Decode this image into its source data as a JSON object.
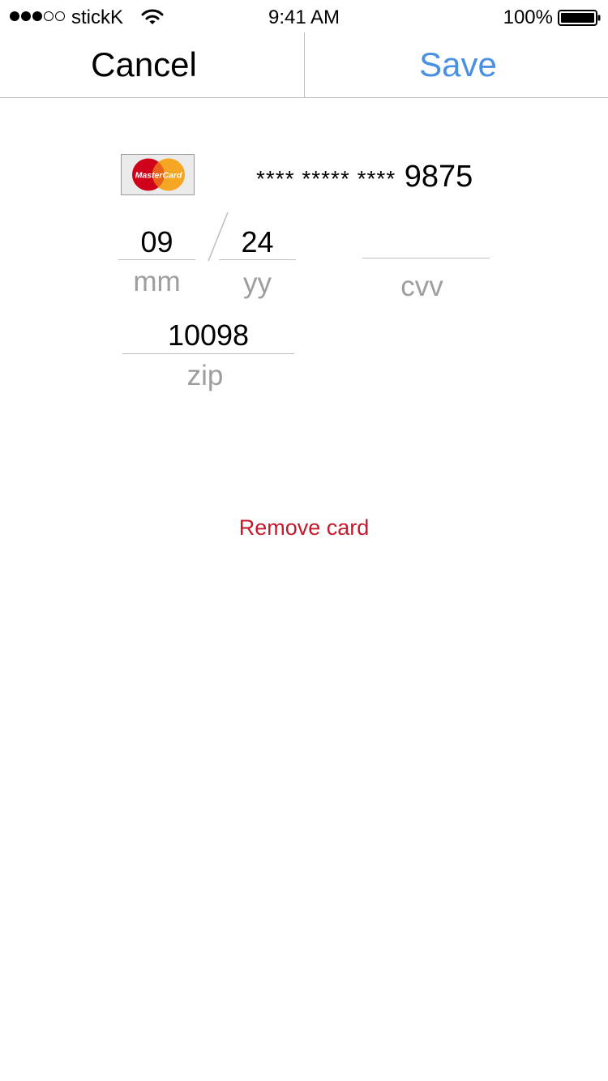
{
  "status_bar": {
    "signal_strength": "3 of 5",
    "carrier": "stickK",
    "time": "9:41 AM",
    "battery_percent": "100%",
    "icons": [
      "signal-dots-icon",
      "wifi-icon",
      "battery-icon"
    ]
  },
  "nav": {
    "cancel_label": "Cancel",
    "save_label": "Save",
    "save_color": "#4a90e2"
  },
  "card": {
    "brand": "MasterCard",
    "brand_logo_icon": "mastercard-icon",
    "masked_number": "**** ***** ****",
    "last_four": "9875"
  },
  "form": {
    "month": {
      "value": "09",
      "label": "mm"
    },
    "year": {
      "value": "24",
      "label": "yy"
    },
    "cvv": {
      "value": "",
      "label": "cvv"
    },
    "zip": {
      "value": "10098",
      "label": "zip"
    }
  },
  "actions": {
    "remove_card_label": "Remove card",
    "remove_card_color": "#c9182b"
  }
}
